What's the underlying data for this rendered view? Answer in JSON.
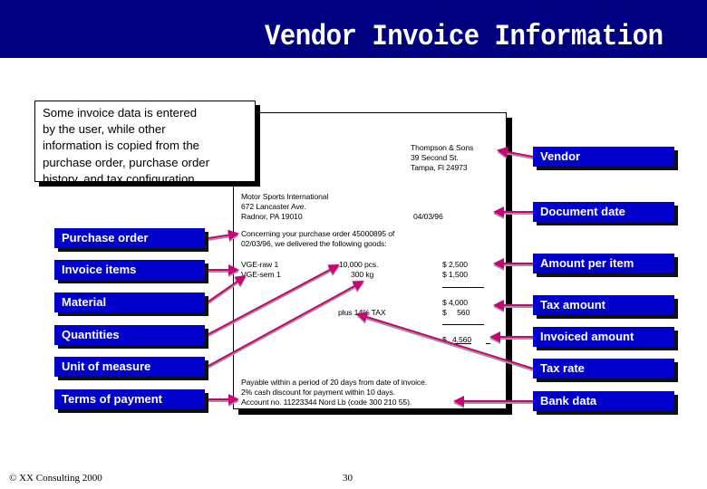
{
  "header": {
    "title": "Vendor Invoice Information"
  },
  "callout": {
    "lines": [
      "Some invoice data is entered",
      "by the user, while other",
      "information is copied from the",
      "purchase order, purchase order",
      "history, and tax configuration."
    ]
  },
  "invoice": {
    "vendor_address": [
      "Thompson & Sons",
      "39 Second St.",
      "Tampa, Fl 24973"
    ],
    "customer_address": [
      "Motor Sports International",
      "672 Lancaster Ave.",
      "Radnor, PA 19010"
    ],
    "document_date": "04/03/96",
    "intro": [
      "Concerning your purchase order 45000895 of",
      "02/03/96, we delivered the following goods:"
    ],
    "items": [
      {
        "material": "VGE-raw 1",
        "quantity": "10,000 pcs.",
        "amount": "$  2,500"
      },
      {
        "material": "VGE-sem 1",
        "quantity": "300 kg",
        "amount": "$  1,500"
      }
    ],
    "subtotal": "$  4,000",
    "tax_label": "plus 14% TAX",
    "tax_amount": "$     560",
    "total_currency": "$",
    "total_amount": "4,560",
    "payment_terms": [
      "Payable within a period of 20 days from date of invoice.",
      "2% cash discount for payment within 10 days.",
      "Account no. 11223344 Nord Lb (code 300 210 55)."
    ]
  },
  "labels_left": [
    "Purchase order",
    "Invoice items",
    "Material",
    "Quantities",
    "Unit of measure",
    "Terms of payment"
  ],
  "labels_right": [
    "Vendor",
    "Document date",
    "Amount per item",
    "Tax amount",
    "Invoiced amount",
    "Tax rate",
    "Bank data"
  ],
  "colors": {
    "header_bg": "#000080",
    "label_bg": "#0000cc",
    "arrow": "#cc0077",
    "arrow_shadow": "#999999"
  },
  "footer": {
    "copyright": "© XX Consulting 2000",
    "page_number": "30"
  }
}
